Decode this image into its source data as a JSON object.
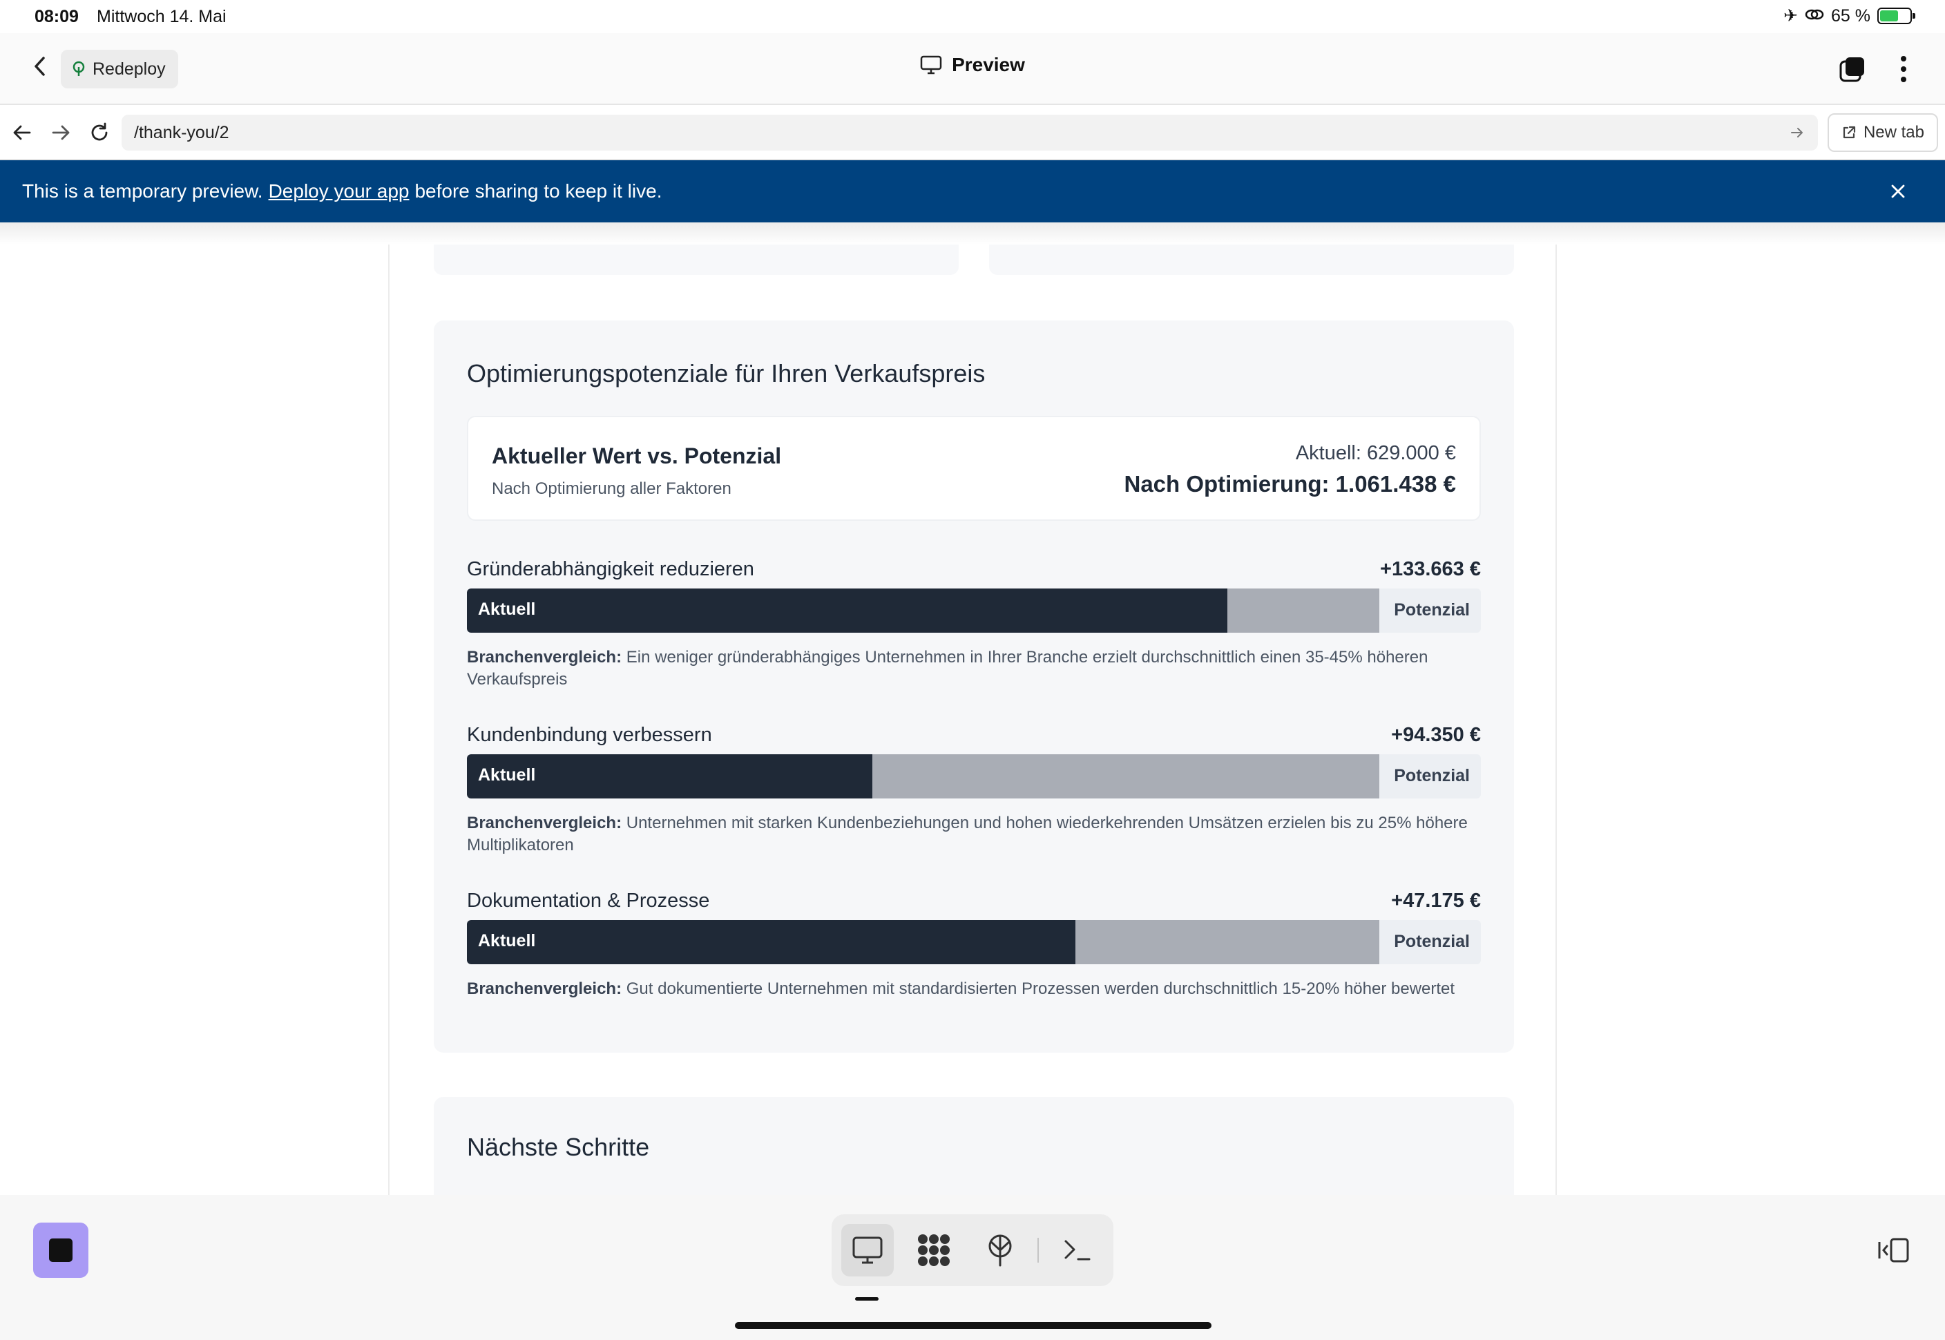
{
  "status_bar": {
    "time": "08:09",
    "date": "Mittwoch 14. Mai",
    "battery": "65 %",
    "battery_level": 0.65
  },
  "app_header": {
    "redeploy_label": "Redeploy",
    "title": "Preview"
  },
  "url_bar": {
    "url": "/thank-you/2",
    "new_tab_label": "New tab"
  },
  "banner": {
    "text_before": "This is a temporary preview.",
    "link_text": "Deploy your app",
    "text_after": "before sharing to keep it live."
  },
  "optimization": {
    "title": "Optimierungspotenziale für Ihren Verkaufspreis",
    "summary": {
      "title": "Aktueller Wert vs. Potenzial",
      "subtitle": "Nach Optimierung aller Faktoren",
      "current": "Aktuell: 629.000 €",
      "optimized": "Nach Optimierung: 1.061.438 €"
    },
    "metrics": [
      {
        "name": "Gründerabhängigkeit reduzieren",
        "gain": "+133.663 €",
        "current_label": "Aktuell",
        "potential_label": "Potenzial",
        "current_fraction": 0.75,
        "potential_fraction": 0.9,
        "desc_label": "Branchenvergleich:",
        "desc": "Ein weniger gründerabhängiges Unternehmen in Ihrer Branche erzielt durchschnittlich einen 35-45% höheren Verkaufspreis"
      },
      {
        "name": "Kundenbindung verbessern",
        "gain": "+94.350 €",
        "current_label": "Aktuell",
        "potential_label": "Potenzial",
        "current_fraction": 0.4,
        "potential_fraction": 0.9,
        "desc_label": "Branchenvergleich:",
        "desc": "Unternehmen mit starken Kundenbeziehungen und hohen wiederkehrenden Umsätzen erzielen bis zu 25% höhere Multiplikatoren"
      },
      {
        "name": "Dokumentation & Prozesse",
        "gain": "+47.175 €",
        "current_label": "Aktuell",
        "potential_label": "Potenzial",
        "current_fraction": 0.6,
        "potential_fraction": 0.9,
        "desc_label": "Branchenvergleich:",
        "desc": "Gut dokumentierte Unternehmen mit standardisierten Prozessen werden durchschnittlich 15-20% höher bewertet"
      }
    ]
  },
  "next_steps": {
    "title": "Nächste Schritte"
  },
  "dock": {
    "icons": [
      "monitor-icon",
      "apps-grid-icon",
      "deploy-icon",
      "terminal-icon"
    ]
  }
}
